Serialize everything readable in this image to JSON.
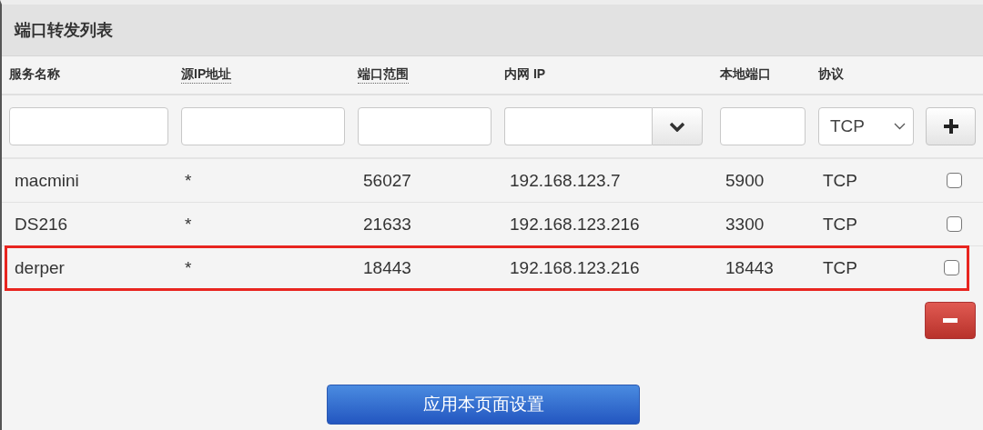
{
  "panel": {
    "title": "端口转发列表"
  },
  "columns": [
    {
      "label": "服务名称",
      "tooltip": false
    },
    {
      "label": "源IP地址",
      "tooltip": true
    },
    {
      "label": "端口范围",
      "tooltip": true
    },
    {
      "label": "内网 IP",
      "tooltip": false
    },
    {
      "label": "本地端口",
      "tooltip": false
    },
    {
      "label": "协议",
      "tooltip": false
    }
  ],
  "new_rule": {
    "protocol": "TCP"
  },
  "rows": [
    {
      "name": "macmini",
      "source_ip": "*",
      "port_range": "56027",
      "internal_ip": "192.168.123.7",
      "local_port": "5900",
      "protocol": "TCP",
      "checked": false,
      "highlighted": false
    },
    {
      "name": "DS216",
      "source_ip": "*",
      "port_range": "21633",
      "internal_ip": "192.168.123.216",
      "local_port": "3300",
      "protocol": "TCP",
      "checked": false,
      "highlighted": false
    },
    {
      "name": "derper",
      "source_ip": "*",
      "port_range": "18443",
      "internal_ip": "192.168.123.216",
      "local_port": "18443",
      "protocol": "TCP",
      "checked": false,
      "highlighted": true
    }
  ],
  "apply_button": "应用本页面设置"
}
